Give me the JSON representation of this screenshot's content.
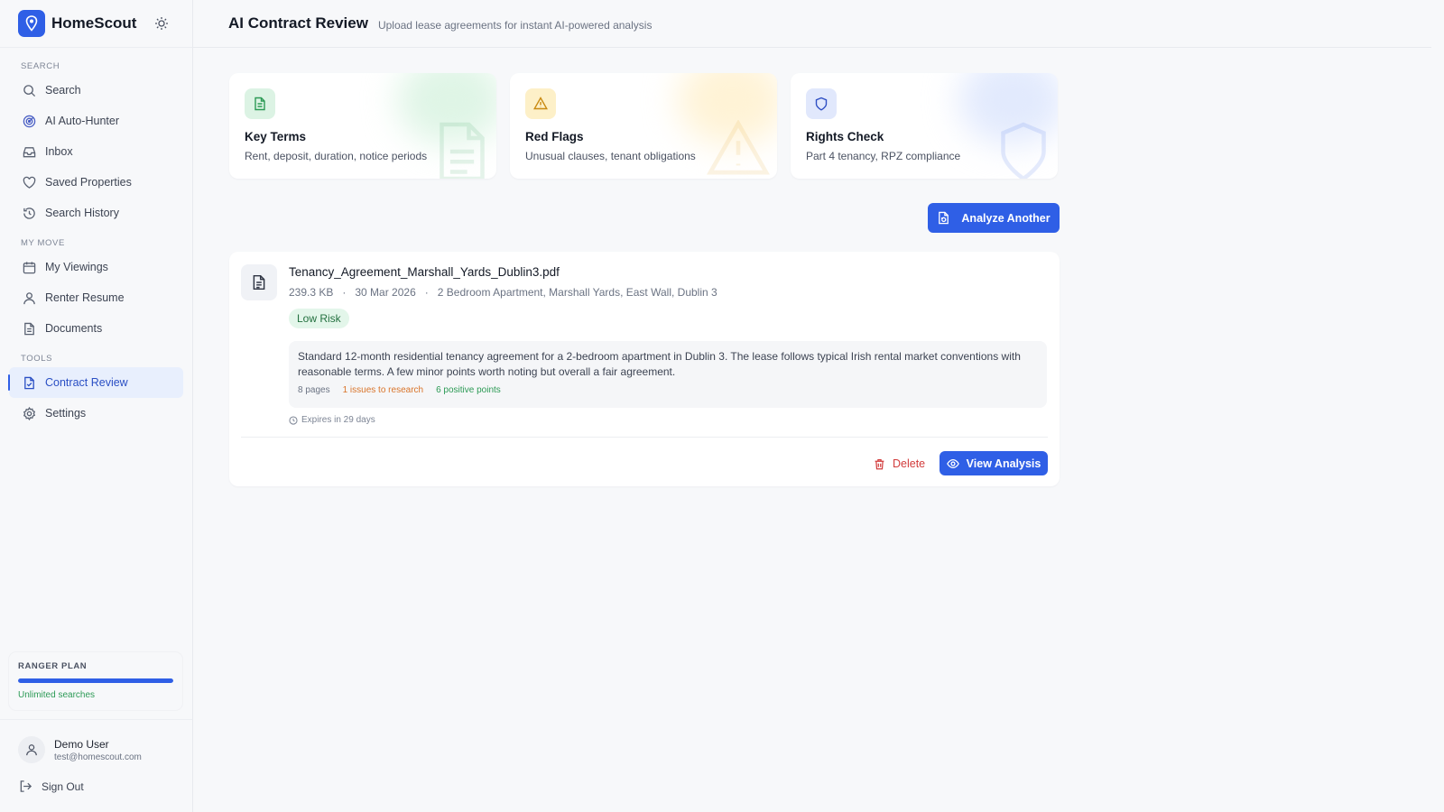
{
  "brand": {
    "name": "HomeScout",
    "logo_icon": "map-pin-icon"
  },
  "colors": {
    "accent": "#2f5fe6",
    "success": "#2c9a55",
    "warning": "#d9742a",
    "danger": "#d23c3c"
  },
  "sidebar": {
    "sections": [
      {
        "label": "SEARCH",
        "items": [
          {
            "label": "Search",
            "icon": "search-icon"
          },
          {
            "label": "AI Auto-Hunter",
            "icon": "radar-icon"
          },
          {
            "label": "Inbox",
            "icon": "inbox-icon"
          },
          {
            "label": "Saved Properties",
            "icon": "heart-icon"
          },
          {
            "label": "Search History",
            "icon": "history-icon"
          }
        ]
      },
      {
        "label": "MY MOVE",
        "items": [
          {
            "label": "My Viewings",
            "icon": "calendar-icon"
          },
          {
            "label": "Renter Resume",
            "icon": "user-icon"
          },
          {
            "label": "Documents",
            "icon": "document-icon"
          }
        ]
      },
      {
        "label": "TOOLS",
        "items": [
          {
            "label": "Contract Review",
            "icon": "file-check-icon",
            "active": true
          },
          {
            "label": "Settings",
            "icon": "gear-icon"
          }
        ]
      }
    ],
    "plan": {
      "title": "RANGER PLAN",
      "subtitle": "Unlimited searches",
      "usage_fraction": 1.0
    },
    "user": {
      "name": "Demo User",
      "email": "test@homescout.com"
    },
    "signout_label": "Sign Out"
  },
  "header": {
    "title": "AI Contract Review",
    "subtitle": "Upload lease agreements for instant AI-powered analysis"
  },
  "features": [
    {
      "title": "Key Terms",
      "desc": "Rent, deposit, duration, notice periods",
      "icon": "document-icon"
    },
    {
      "title": "Red Flags",
      "desc": "Unusual clauses, tenant obligations",
      "icon": "warning-icon"
    },
    {
      "title": "Rights Check",
      "desc": "Part 4 tenancy, RPZ compliance",
      "icon": "shield-icon"
    }
  ],
  "analyze_button": "Analyze Another",
  "contract": {
    "file_name": "Tenancy_Agreement_Marshall_Yards_Dublin3.pdf",
    "size": "239.3 KB",
    "date": "30 Mar 2026",
    "property": "2 Bedroom Apartment, Marshall Yards, East Wall, Dublin 3",
    "sep": "·",
    "risk": "Low Risk",
    "summary": "Standard 12-month residential tenancy agreement for a 2-bedroom apartment in Dublin 3. The lease follows typical Irish rental market conventions with reasonable terms. A few minor points worth noting but overall a fair agreement.",
    "pages": "8 pages",
    "issues": "1 issues to research",
    "positives": "6 positive points",
    "expires": "Expires in 29 days",
    "delete_label": "Delete",
    "view_label": "View Analysis"
  }
}
